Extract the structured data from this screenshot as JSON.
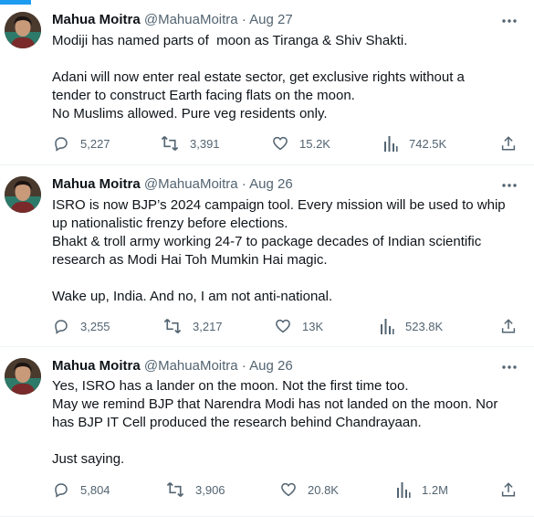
{
  "tweets": [
    {
      "author_name": "Mahua Moitra",
      "handle": "@MahuaMoitra",
      "separator": "·",
      "date": "Aug 27",
      "text_lines": [
        "Modiji has named parts of  moon as Tiranga & Shiv Shakti.",
        "",
        "Adani will now enter real estate sector, get exclusive rights without a",
        "tender to construct Earth facing flats on the moon.",
        "No Muslims allowed. Pure veg residents only."
      ],
      "replies": "5,227",
      "retweets": "3,391",
      "likes": "15.2K",
      "views": "742.5K"
    },
    {
      "author_name": "Mahua Moitra",
      "handle": "@MahuaMoitra",
      "separator": "·",
      "date": "Aug 26",
      "text_lines": [
        "ISRO is now BJP’s 2024 campaign tool. Every mission will be used to whip",
        "up nationalistic frenzy before elections.",
        "Bhakt & troll army working 24-7 to package decades of Indian scientific",
        "research as Modi Hai Toh Mumkin Hai magic.",
        "",
        "Wake up, India. And no, I am not anti-national."
      ],
      "replies": "3,255",
      "retweets": "3,217",
      "likes": "13K",
      "views": "523.8K"
    },
    {
      "author_name": "Mahua Moitra",
      "handle": "@MahuaMoitra",
      "separator": "·",
      "date": "Aug 26",
      "text_lines": [
        "Yes, ISRO has a lander on the moon. Not the first time too.",
        "May we remind BJP that Narendra Modi has not landed on the moon. Nor",
        "has BJP IT Cell produced the research behind Chandrayaan.",
        "",
        "Just saying."
      ],
      "replies": "5,804",
      "retweets": "3,906",
      "likes": "20.8K",
      "views": "1.2M"
    }
  ],
  "icons": {
    "more": "more-horizontal-icon",
    "reply": "reply-icon",
    "retweet": "retweet-icon",
    "like": "heart-icon",
    "views": "views-bar-chart-icon",
    "share": "share-upload-icon"
  },
  "colors": {
    "text": "#0f1419",
    "secondary": "#536471",
    "divider": "#eff3f4",
    "accent": "#1d9bf0"
  }
}
